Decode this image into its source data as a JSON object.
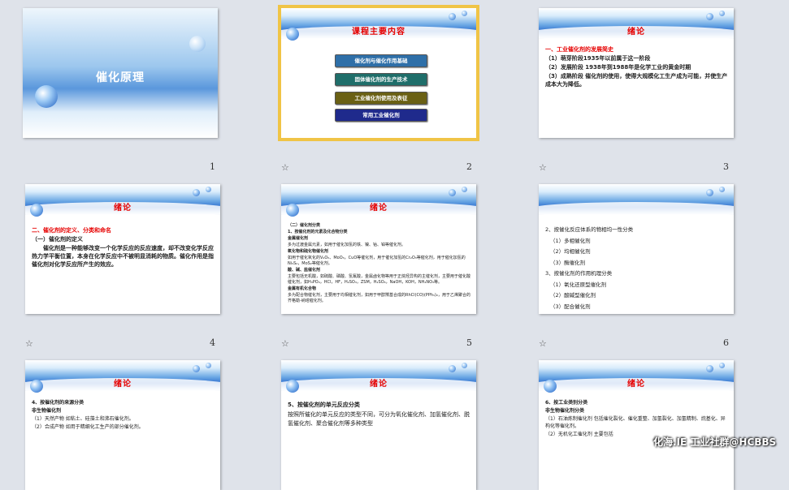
{
  "slides": [
    {
      "number": "1",
      "title": "催化原理"
    },
    {
      "number": "2",
      "title": "课程主要内容",
      "items": [
        "催化剂与催化作用基础",
        "固体催化剂的生产技术",
        "工业催化剂使用及表征",
        "常用工业催化剂"
      ],
      "item_colors": [
        "#2e6fa8",
        "#1f6e6a",
        "#6a6014",
        "#1f2a8c"
      ]
    },
    {
      "number": "3",
      "title": "绪论",
      "lines": [
        "一、工业催化剂的发展简史",
        "（1）萌芽阶段1935年以前属于这一阶段",
        "（2）发展阶段  1938年到1988年是化学工业的黄金时期",
        "（3）成熟阶段  催化剂的使用，使得大规模化工生产成为可能，并使生产成本大为降低。"
      ]
    },
    {
      "number": "4",
      "title": "绪论",
      "lines": [
        "二、催化剂的定义、分类和命名",
        "（一）催化剂的定义",
        "催化剂是一种能够改变一个化学反应的反应速度，却不改变化学反应热力学平衡位置，本身在化学反应中不被明显消耗的物质。催化作用是指催化剂对化学反应所产生的效应。"
      ]
    },
    {
      "number": "5",
      "title": "绪论",
      "lines": [
        "（二）催化剂分类",
        "1、按催化剂的元素及化合物分类",
        "金属催化剂",
        "多为过渡金属元素，如用于催化加氢的铁、镍、钴、铂等催化剂。",
        "氧化物和硫化物催化剂",
        "如用于催化氧化的V₂O₅、MoO₃，CuO等催化剂，用于催化加氢的Cr₂O₃等催化剂，用于催化加氢的Ni₃S₂，MoS₂等催化剂。",
        "酸、碱、盐催化剂",
        "主要包括无机酸，如硫酸、磷酸、氢氟酸，金属卤化物等用于正烷烃异构的主催化剂，主要用于催化酸催化剂，如H₃PO₄，HCl，HF，H₂SO₄，ZSM，H₂SO₄，NaOH，KOH，NH₄NO₃等。",
        "金属有机化合物",
        "多为配合物催化剂，主要用于均相催化剂，如用于甲醇羰基合成的RhCl(CO)(PPh₃)₂，用于乙烯聚合的齐格勒-纳塔催化剂。"
      ]
    },
    {
      "number": "6",
      "lines": [
        "2、按催化反应体系的物相均一性分类",
        "（1）多相催化剂",
        "（2）均相催化剂",
        "（3）酶催化剂",
        "3、按催化剂的作用机理分类",
        "（1）氧化还原型催化剂",
        "（2）酸碱型催化剂",
        "（3）配合催化剂"
      ]
    },
    {
      "title": "绪论",
      "lines": [
        "4、按催化剂的来源分类",
        "非生物催化剂",
        "（1）天然产物  如粘土、硅藻土和沸石催化剂。",
        "（2）合成产物  如用于精细化工生产的部分催化剂。"
      ]
    },
    {
      "title": "绪论",
      "lines": [
        "5、按催化剂的单元反应分类",
        "按照所催化的单元反应的类型不同，可分为氧化催化剂、加氢催化剂、脱氢催化剂、聚合催化剂等多种类型"
      ]
    },
    {
      "title": "绪论",
      "lines": [
        "6、按工业类别分类",
        "非生物催化剂分类",
        "（1）石油炼制催化剂  包括催化裂化、催化重整、加氢裂化、加氢精制、烷基化、异构化等催化剂。",
        "（2）无机化工催化剂  主要包括"
      ]
    }
  ],
  "star_icon": "☆",
  "watermark": "化海.IE 工业社群@HCBBS"
}
